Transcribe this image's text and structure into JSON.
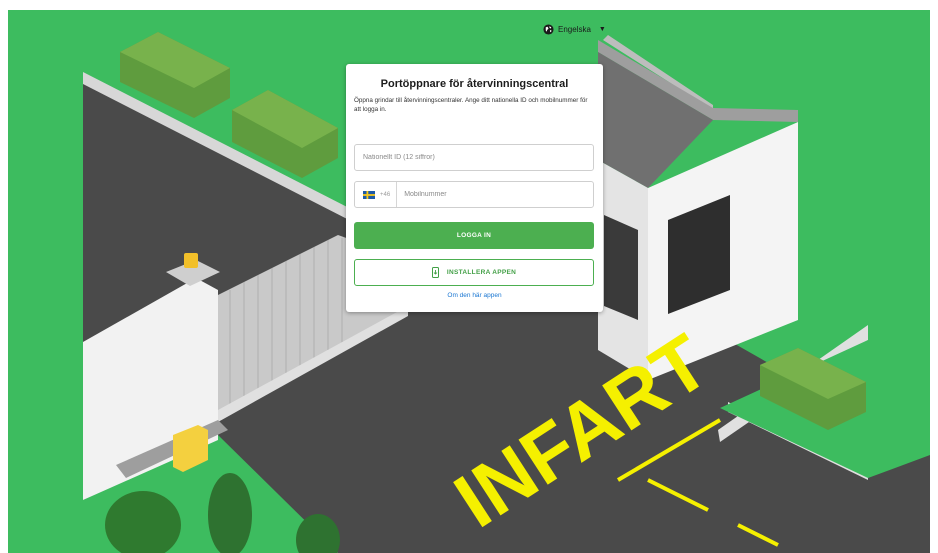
{
  "language": {
    "label": "Engelska",
    "icon": "globe-icon"
  },
  "login": {
    "title": "Portöppnare för återvinningscentral",
    "description": "Öppna grindar till återvinningscentraler. Ange ditt nationella ID och mobilnummer för att logga in.",
    "national_id_placeholder": "Nationellt ID (12 siffror)",
    "country_code": "+46",
    "country_flag": "sweden-flag-icon",
    "phone_placeholder": "Mobilnummer",
    "login_button": "LOGGA IN",
    "install_button": "INSTALLERA APPEN",
    "install_icon": "phone-download-icon",
    "about_link": "Om den här appen"
  },
  "illustration": {
    "road_marking": "INFART"
  },
  "colors": {
    "background_green": "#3dbc5f",
    "primary_green": "#4caf50",
    "link_blue": "#1976d2",
    "road_marking_yellow": "#f5f000"
  }
}
